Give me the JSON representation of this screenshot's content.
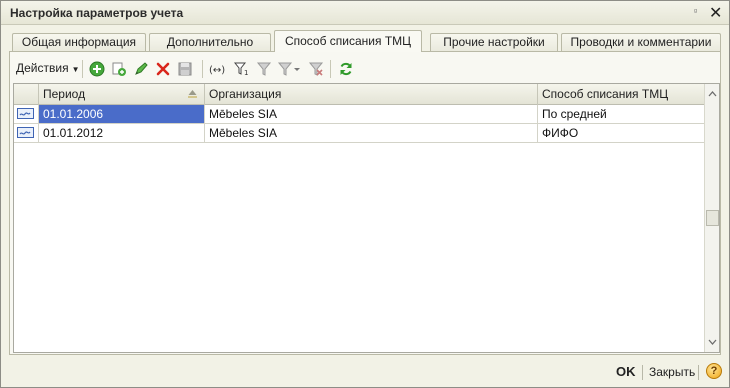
{
  "window": {
    "title": "Настройка параметров учета",
    "pin_glyph": "ᵍ",
    "close_glyph": "✕"
  },
  "tabs": [
    {
      "label": "Общая информация",
      "active": false
    },
    {
      "label": "Дополнительно",
      "active": false
    },
    {
      "label": "Способ списания ТМЦ",
      "active": true
    },
    {
      "label": "Прочие настройки",
      "active": false
    },
    {
      "label": "Проводки и комментарии",
      "active": false
    }
  ],
  "toolbar": {
    "actions_label": "Действия",
    "buttons": [
      "add-icon",
      "copy-icon",
      "edit-icon",
      "delete-icon",
      "save-icon",
      "history-icon",
      "period-filter-icon",
      "filter-icon",
      "filter-dropdown-icon",
      "clear-filter-icon",
      "refresh-icon"
    ]
  },
  "table": {
    "columns": [
      "Период",
      "Организация",
      "Способ списания ТМЦ"
    ],
    "rows": [
      {
        "period": "01.01.2006",
        "organization": "Mēbeles SIA",
        "method": "По средней"
      },
      {
        "period": "01.01.2012",
        "organization": "Mēbeles SIA",
        "method": "ФИФО"
      }
    ],
    "selected_row": 0
  },
  "footer": {
    "ok_label": "OK",
    "close_label": "Закрыть",
    "help_glyph": "?"
  },
  "colors": {
    "selection": "#4a6cc9",
    "window_bg": "#f2f2e6",
    "accent_green": "#3aa535",
    "accent_red": "#d9261c"
  }
}
